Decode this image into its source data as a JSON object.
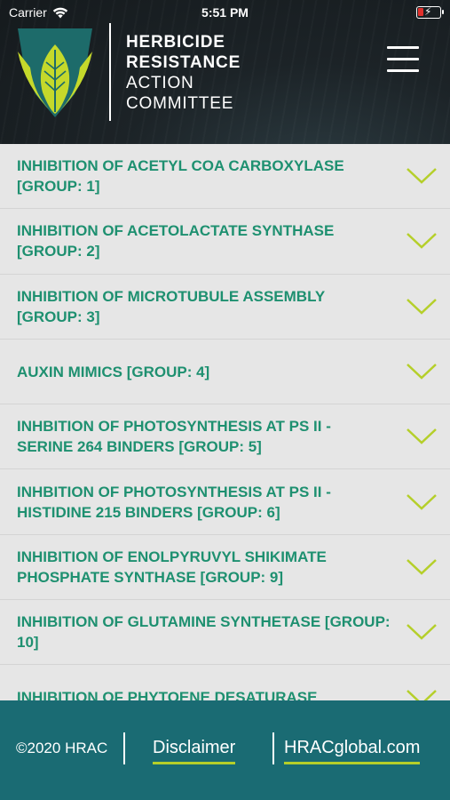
{
  "status_bar": {
    "carrier": "Carrier",
    "time": "5:51 PM"
  },
  "header": {
    "line1": "HERBICIDE",
    "line2": "RESISTANCE",
    "line3": "ACTION",
    "line4": "COMMITTEE"
  },
  "list": {
    "items": [
      {
        "label": "INHIBITION OF ACETYL COA CARBOXYLASE [GROUP: 1]"
      },
      {
        "label": "INHIBITION OF ACETOLACTATE SYNTHASE [GROUP: 2]"
      },
      {
        "label": "INHIBITION OF MICROTUBULE ASSEMBLY [GROUP: 3]"
      },
      {
        "label": "AUXIN MIMICS [GROUP: 4]"
      },
      {
        "label": "INHBITION OF PHOTOSYNTHESIS AT PS II - SERINE 264 BINDERS [GROUP: 5]"
      },
      {
        "label": "INHBITION OF PHOTOSYNTHESIS AT PS II - HISTIDINE 215 BINDERS [GROUP: 6]"
      },
      {
        "label": "INHIBITION OF ENOLPYRUVYL SHIKIMATE PHOSPHATE SYNTHASE [GROUP: 9]"
      },
      {
        "label": "INHIBITION OF GLUTAMINE SYNTHETASE [GROUP: 10]"
      },
      {
        "label": "INHIBITION OF PHYTOENE DESATURASE"
      }
    ]
  },
  "footer": {
    "copyright": "©2020 HRAC",
    "disclaimer": "Disclaimer",
    "website": "HRACglobal.com"
  },
  "colors": {
    "accent": "#1e9070",
    "lime": "#b5cf2a",
    "footer_bg": "#1a6b73",
    "header_bg": "#1c2327"
  }
}
